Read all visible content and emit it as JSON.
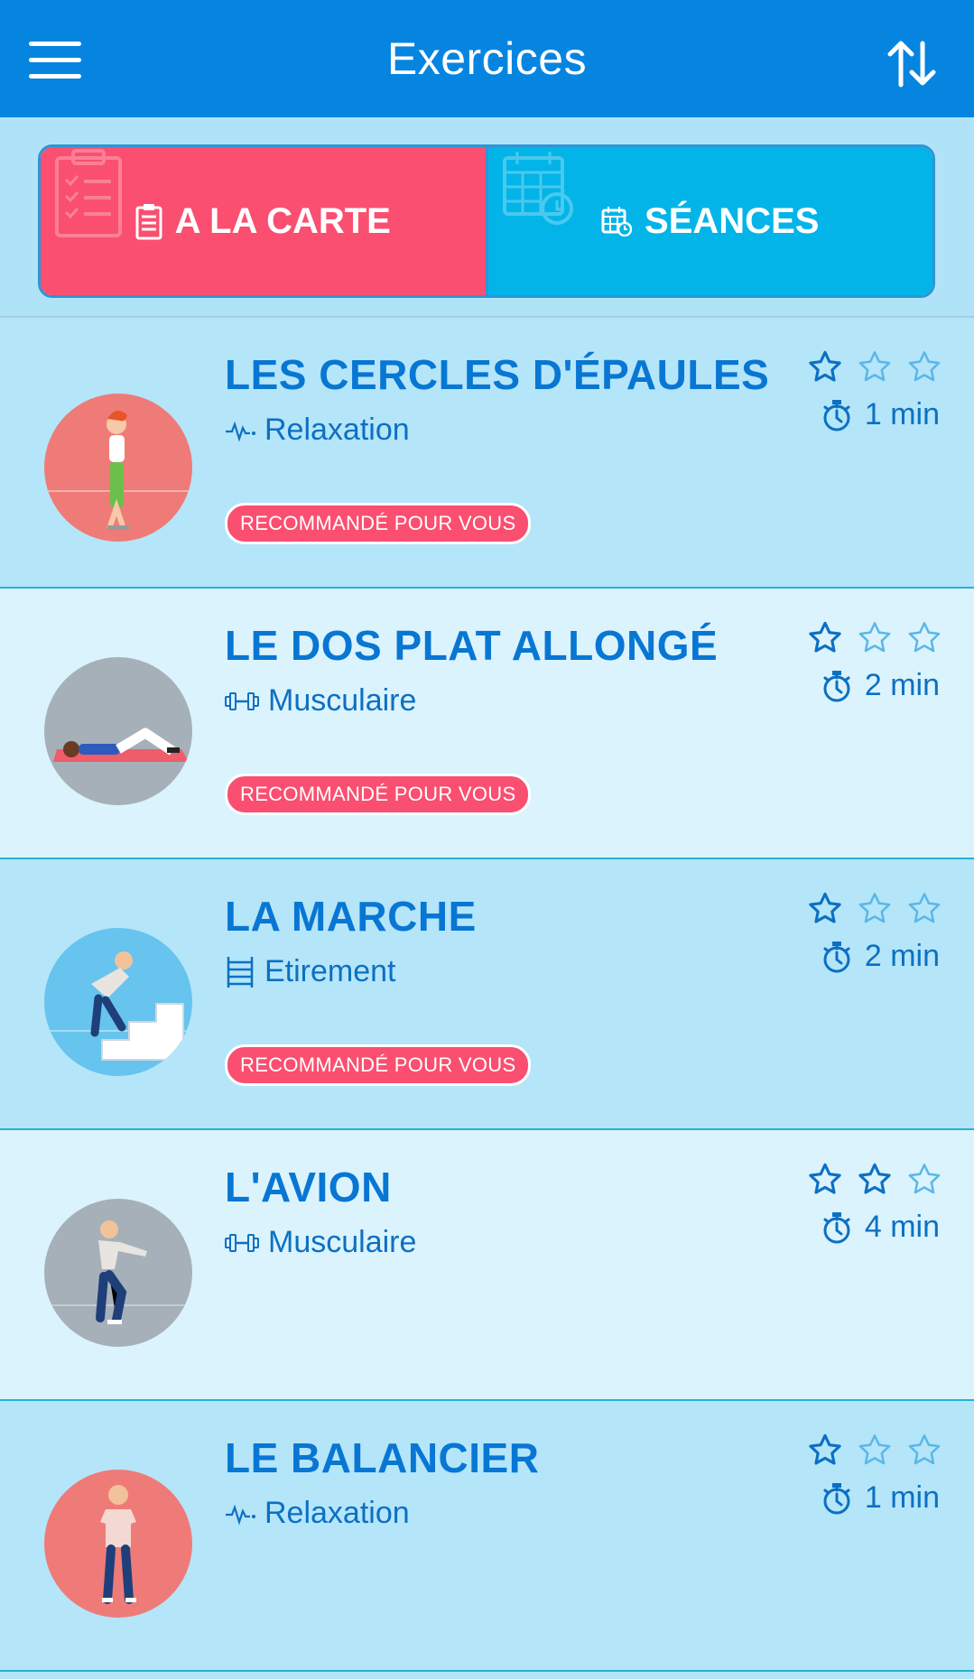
{
  "header": {
    "title": "Exercices"
  },
  "tabs": [
    {
      "label": "A LA CARTE",
      "active": true
    },
    {
      "label": "SÉANCES",
      "active": false
    }
  ],
  "exercises": [
    {
      "title": "LES CERCLES D'ÉPAULES",
      "category": "Relaxation",
      "category_icon": "pulse-icon",
      "badge": "RECOMMANDÉ POUR VOUS",
      "rating": 1,
      "duration": "1 min",
      "thumb_color": "#ef7b78"
    },
    {
      "title": "LE DOS PLAT ALLONGÉ",
      "category": "Musculaire",
      "category_icon": "dumbbell-icon",
      "badge": "RECOMMANDÉ POUR VOUS",
      "rating": 1,
      "duration": "2 min",
      "thumb_color": "#a6b0b8"
    },
    {
      "title": "LA MARCHE",
      "category": "Etirement",
      "category_icon": "ladder-icon",
      "badge": "RECOMMANDÉ POUR VOUS",
      "rating": 1,
      "duration": "2 min",
      "thumb_color": "#66c4ee"
    },
    {
      "title": "L'AVION",
      "category": "Musculaire",
      "category_icon": "dumbbell-icon",
      "badge": "",
      "rating": 2,
      "duration": "4 min",
      "thumb_color": "#a6b0b8"
    },
    {
      "title": "LE BALANCIER",
      "category": "Relaxation",
      "category_icon": "pulse-icon",
      "badge": "",
      "rating": 1,
      "duration": "1 min",
      "thumb_color": "#ef7b78"
    }
  ],
  "colors": {
    "header": "#0585e0",
    "accent_pink": "#fa4f70",
    "accent_cyan": "#03b4e8",
    "title_blue": "#0876d3"
  }
}
